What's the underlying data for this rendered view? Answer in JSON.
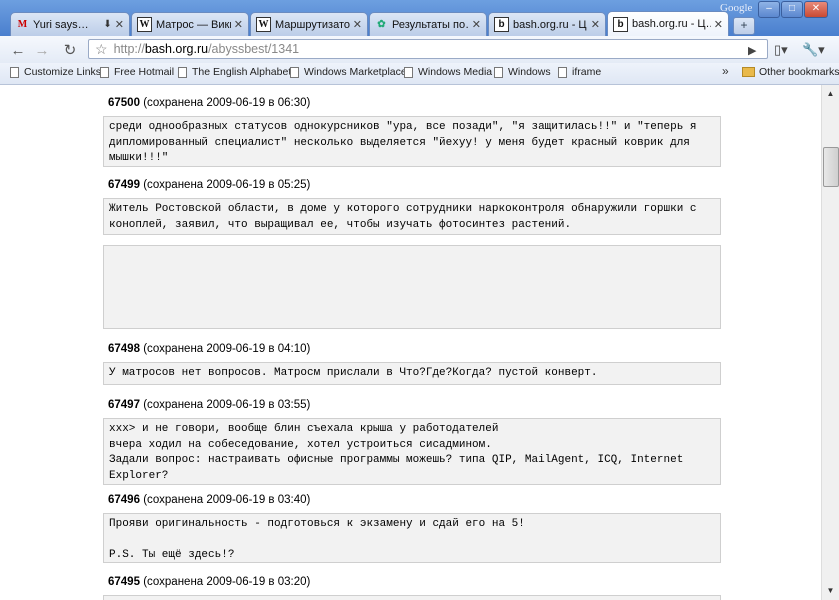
{
  "browser": {
    "brand": "Google",
    "tabs": [
      {
        "title": "Yuri says…",
        "icon": "gmail-icon",
        "glyph": "M",
        "extra": "⬇"
      },
      {
        "title": "Матрос — Вики…",
        "icon": "wikipedia-icon",
        "glyph": "W"
      },
      {
        "title": "Маршрутизато…",
        "icon": "wikipedia-icon",
        "glyph": "W"
      },
      {
        "title": "Результаты по…",
        "icon": "search-result-icon",
        "glyph": "✿"
      },
      {
        "title": "bash.org.ru - Ц…",
        "icon": "bash-icon",
        "glyph": "b"
      },
      {
        "title": "bash.org.ru - Ц…",
        "icon": "bash-icon",
        "glyph": "b"
      }
    ],
    "close_glyph": "✕",
    "new_tab_glyph": "+",
    "window_buttons": {
      "minimize": "–",
      "maximize": "□",
      "close": "✕"
    }
  },
  "toolbar": {
    "back": "←",
    "forward": "→",
    "reload": "↻",
    "star": "☆",
    "url_scheme": "http://",
    "url_host": "bash.org.ru",
    "url_path": "/abyssbest/1341",
    "go": "▶",
    "page_menu": "▯▾",
    "wrench_menu": "🔧▾"
  },
  "bookmarks": {
    "items": [
      {
        "label": "Customize Links",
        "icon": "page-icon"
      },
      {
        "label": "Free Hotmail",
        "icon": "page-icon"
      },
      {
        "label": "The English Alphabet",
        "icon": "page-icon"
      },
      {
        "label": "Windows Marketplace",
        "icon": "page-icon"
      },
      {
        "label": "Windows Media",
        "icon": "page-icon"
      },
      {
        "label": "Windows",
        "icon": "page-icon"
      },
      {
        "label": "iframe",
        "icon": "page-icon"
      }
    ],
    "overflow": "»",
    "other": "Other bookmarks"
  },
  "quotes": [
    {
      "id": "67500",
      "meta": "(сохранена 2009-06-19 в 06:30)",
      "text": "среди однообразных статусов однокурсников \"ура, все позади\", \"я защитилась!!\" и \"теперь я дипломированный специалист\" несколько выделяется \"йехуу! у меня будет красный коврик для мышки!!!\""
    },
    {
      "id": "67499",
      "meta": "(сохранена 2009-06-19 в 05:25)",
      "text": "Житель Ростовской области, в доме у которого сотрудники наркоконтроля обнаружили горшки с коноплей, заявил, что выращивал ее, чтобы изучать фотосинтез растений."
    },
    {
      "id": "67498",
      "meta": "(сохранена 2009-06-19 в 04:10)",
      "text": "У матросов нет вопросов. Матросм прислали в Что?Где?Когда? пустой конверт."
    },
    {
      "id": "67497",
      "meta": "(сохранена 2009-06-19 в 03:55)",
      "text": "xxx> и не говори, вообще блин съехала крыша у работодателей\nвчера ходил на собеседование, хотел устроиться сисадмином.\nЗадали вопрос: настраивать офисные программы можешь? типа QIP, MailAgent, ICQ, Internet Explorer?"
    },
    {
      "id": "67496",
      "meta": "(сохранена 2009-06-19 в 03:40)",
      "text": "Прояви оригинальность - подготовься к экзамену и сдай его на 5!\n\nP.S. Ты ещё здесь!?"
    },
    {
      "id": "67495",
      "meta": "(сохранена 2009-06-19 в 03:20)",
      "text": ""
    }
  ],
  "scrollbar": {
    "up": "▲",
    "down": "▼"
  }
}
